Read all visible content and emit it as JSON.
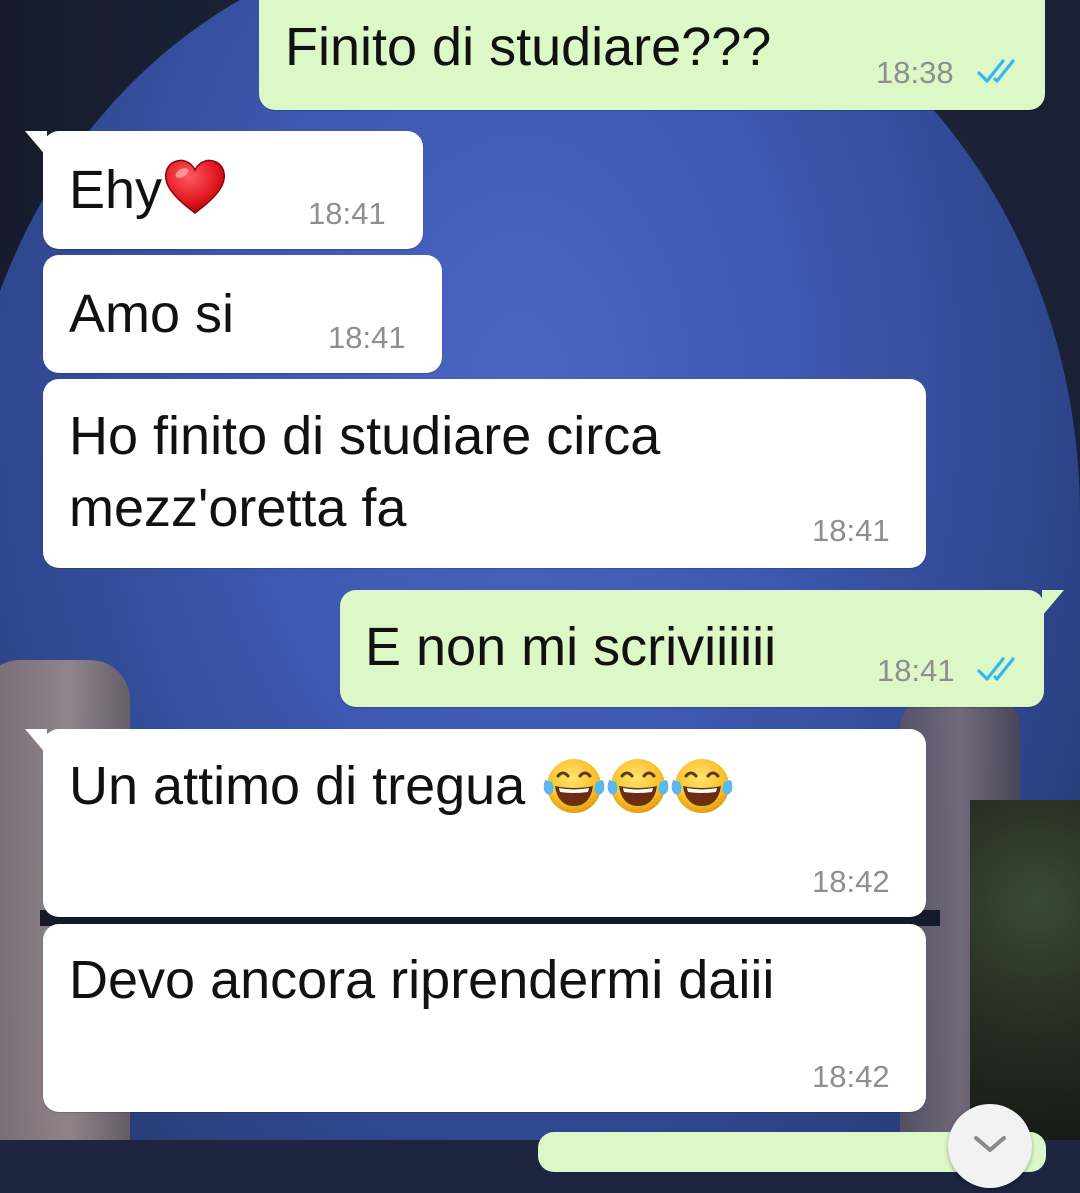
{
  "messages": [
    {
      "text": "Finito di studiare???",
      "time": "18:38",
      "direction": "outgoing",
      "status": "read"
    },
    {
      "text": "Ehy",
      "emoji": "red-heart",
      "time": "18:41",
      "direction": "incoming"
    },
    {
      "text": "Amo si",
      "time": "18:41",
      "direction": "incoming"
    },
    {
      "text": "Ho finito di studiare circa\nmezz'oretta fa",
      "time": "18:41",
      "direction": "incoming"
    },
    {
      "text": "E non mi scriviiiiii",
      "time": "18:41",
      "direction": "outgoing",
      "status": "read"
    },
    {
      "text": "Un attimo di tregua ",
      "emoji": "face-with-tears-of-joy x3",
      "time": "18:42",
      "direction": "incoming"
    },
    {
      "text": "Devo ancora riprendermi daiii",
      "time": "18:42",
      "direction": "incoming"
    }
  ],
  "colors": {
    "outgoing_bubble": "#dcf8c6",
    "incoming_bubble": "#ffffff",
    "read_tick": "#34b7f1",
    "timestamp": "#8e8e8e"
  },
  "icons": {
    "read_receipt": "double-check-icon",
    "scroll_down": "chevron-down-icon"
  }
}
